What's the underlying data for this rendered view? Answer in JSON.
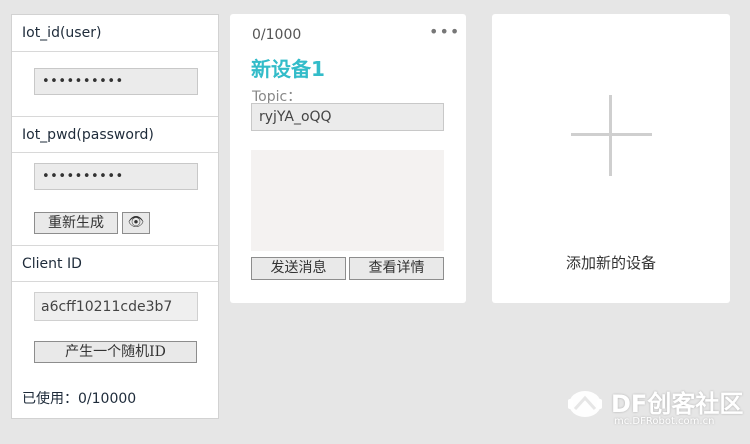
{
  "credentials": {
    "iot_id_label": "Iot_id(user)",
    "iot_id_value": "••••••••••",
    "iot_pwd_label": "Iot_pwd(password)",
    "iot_pwd_value": "••••••••••",
    "regenerate_button": "重新生成",
    "show_password_icon": "eye-icon",
    "client_id_label": "Client ID",
    "client_id_value": "a6cff10211cde3b7",
    "random_id_button": "产生一个随机ID",
    "used_text": "已使用：0/10000"
  },
  "device": {
    "count": "0/1000",
    "more_icon": "more-icon",
    "name": "新设备1",
    "topic_label": "Topic：",
    "topic_value": "ryjYA_oQQ",
    "send_button": "发送消息",
    "details_button": "查看详情",
    "accent_color": "#33bcc9"
  },
  "add_device": {
    "label": "添加新的设备",
    "plus_icon": "plus-icon"
  },
  "watermark": {
    "brand": "DF创客社区",
    "url": "mc.DFRobot.com.cn"
  }
}
